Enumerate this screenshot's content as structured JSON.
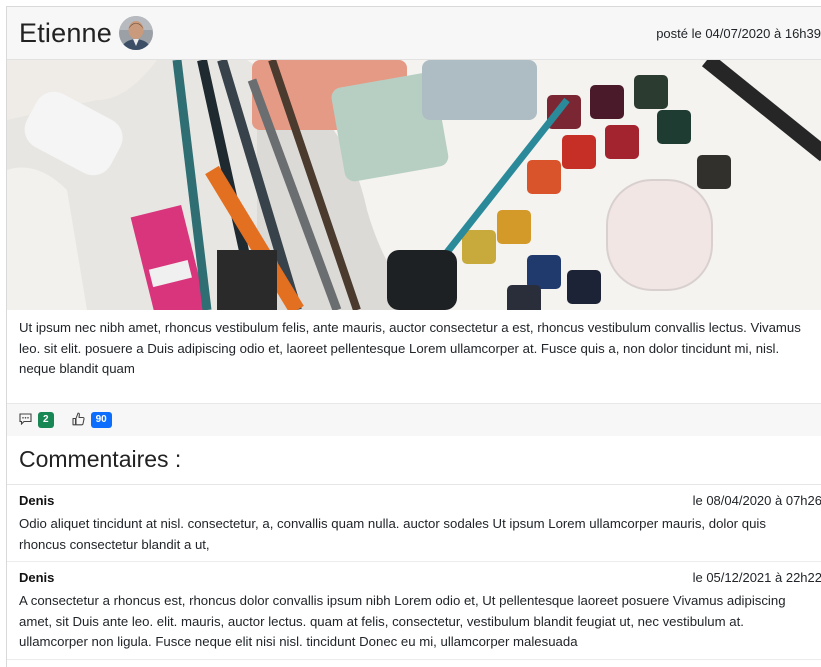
{
  "post": {
    "author": "Etienne",
    "date": "posté le 04/07/2020 à 16h39",
    "body": "Ut ipsum nec nibh amet, rhoncus vestibulum felis, ante mauris, auctor consectetur a est, rhoncus vestibulum convallis lectus. Vivamus leo. sit elit. posuere a Duis adipiscing odio et, laoreet pellentesque Lorem ullamcorper at. Fusce quis a, non dolor tincidunt mi, nisl. neque blandit quam",
    "comments_count": "2",
    "likes_count": "90"
  },
  "comments_title": "Commentaires :",
  "comments": [
    {
      "author": "Denis",
      "date": "le 08/04/2020 à 07h26",
      "text": "Odio aliquet tincidunt at nisl. consectetur, a, convallis quam nulla. auctor sodales Ut ipsum Lorem ullamcorper mauris, dolor quis rhoncus consectetur blandit a ut,"
    },
    {
      "author": "Denis",
      "date": "le 05/12/2021 à 22h22",
      "text": "A consectetur a rhoncus est, rhoncus dolor convallis ipsum nibh Lorem odio et, Ut pellentesque laoreet posuere Vivamus adipiscing amet, sit Duis ante leo. elit. mauris, auctor lectus. quam at felis, consectetur, vestibulum blandit feugiat ut, nec vestibulum at. ullamcorper non ligula. Fusce neque elit nisi nisl. tincidunt Donec eu mi, ullamcorper malesuada"
    }
  ],
  "icons": {
    "comments": "comment-icon",
    "likes": "thumbs-up-icon"
  },
  "colors": {
    "comments_badge": "#198754",
    "likes_badge": "#0d6efd"
  }
}
